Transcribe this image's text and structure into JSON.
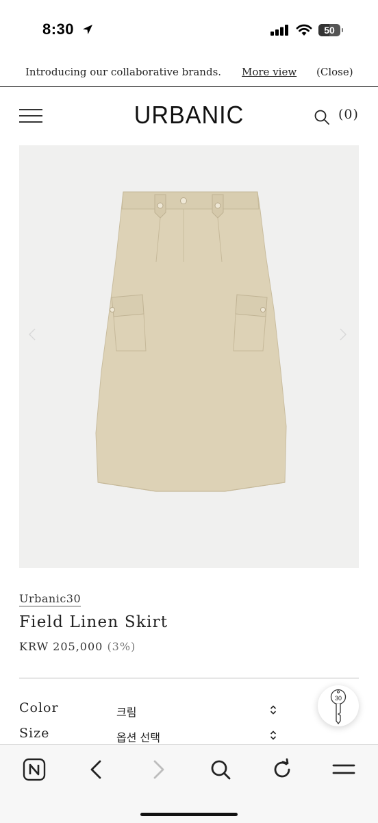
{
  "status_bar": {
    "time": "8:30",
    "battery": "50",
    "battery_level": 0.5,
    "icons": [
      "location-arrow-icon",
      "cellular-signal-icon",
      "wifi-icon",
      "battery-icon"
    ]
  },
  "promo": {
    "text": "Introducing our collaborative brands.",
    "link_label": "More view",
    "close_label": "(Close)"
  },
  "header": {
    "logo": "URBANIC",
    "cart_count": "(0)",
    "icons": [
      "hamburger-menu-icon",
      "search-icon"
    ]
  },
  "gallery": {
    "image": "beige linen cargo midi skirt",
    "icons": [
      "chevron-left-icon",
      "chevron-right-icon"
    ]
  },
  "product": {
    "brand": "Urbanic30",
    "name": "Field Linen Skirt",
    "price": "KRW 205,000",
    "discount": "(3%)"
  },
  "options": [
    {
      "label": "Color",
      "value": "크림"
    },
    {
      "label": "Size",
      "value": "옵션 선택"
    }
  ],
  "coupon": {
    "badge": "30",
    "icon": "key-tag-icon"
  },
  "browser_toolbar": {
    "buttons": [
      "naver-home-icon",
      "back-arrow-icon",
      "forward-arrow-icon",
      "search-icon",
      "reload-icon",
      "menu-icon"
    ]
  },
  "colors": {
    "text": "#222222",
    "image_bg": "#f0f0ef",
    "skirt": "#ddd2b6",
    "toolbar_bg": "#f7f7f7"
  }
}
